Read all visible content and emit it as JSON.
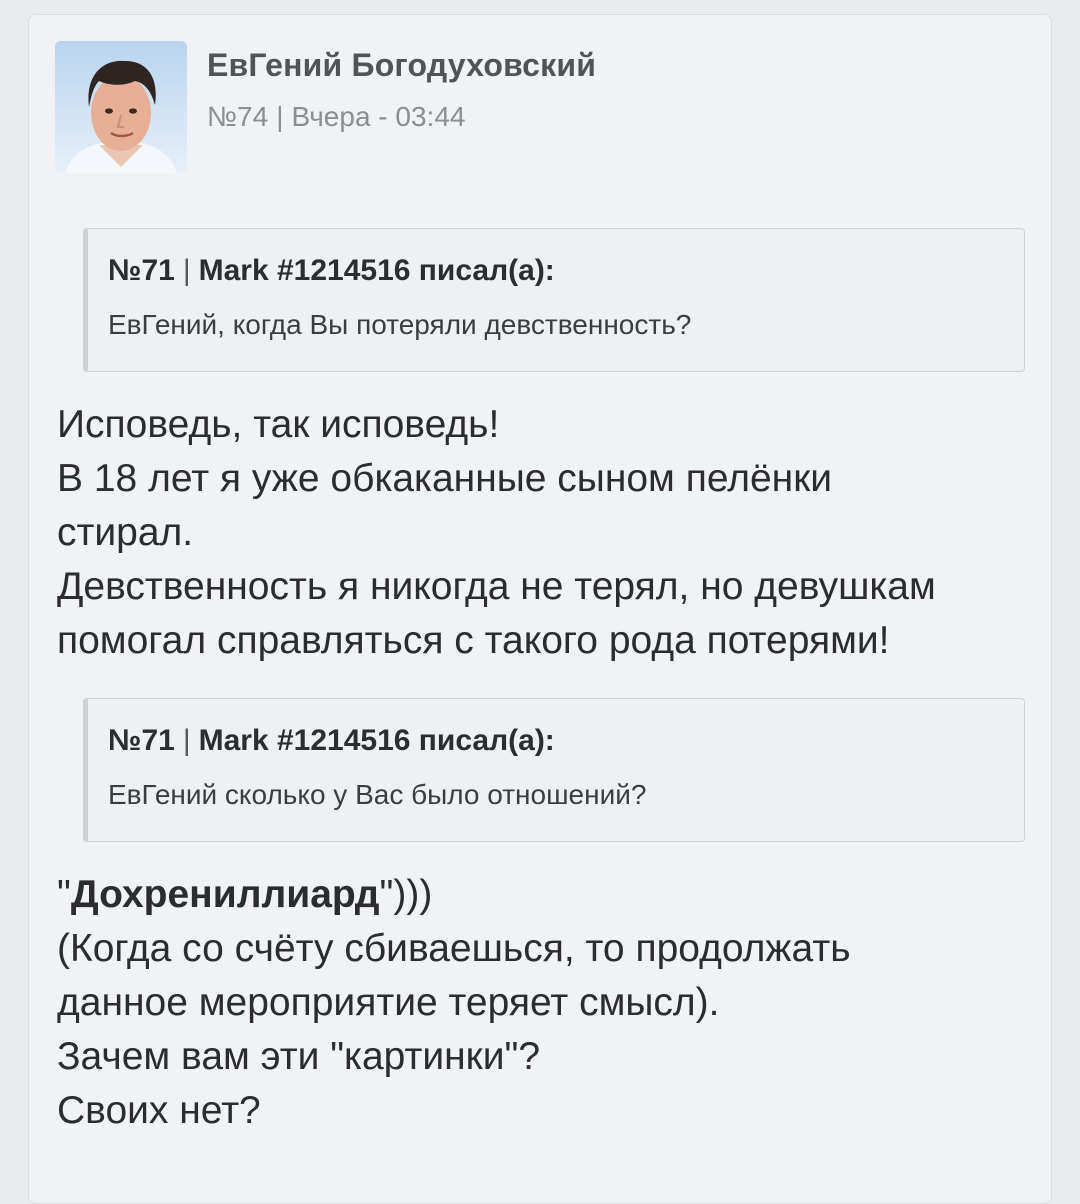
{
  "post": {
    "author": "ЕвГений Богодуховский",
    "number": "№74",
    "separator": "|",
    "time": "Вчера - 03:44",
    "avatar_icon": "user-photo-avatar"
  },
  "quotes": [
    {
      "number": "№71",
      "separator": "|",
      "author_label": "Mark #1214516 писал(а):",
      "text": "ЕвГений, когда Вы потеряли девственность?"
    },
    {
      "number": "№71",
      "separator": "|",
      "author_label": "Mark #1214516 писал(а):",
      "text": "ЕвГений сколько у Вас было отношений?"
    }
  ],
  "body1": {
    "lines": [
      "Исповедь, так исповедь!",
      "В 18 лет я уже обкаканные сыном пелёнки",
      "стирал.",
      "Девственность я никогда не терял, но девушкам",
      "помогал справляться с такого рода потерями!"
    ]
  },
  "body2": {
    "quote_open": "\"",
    "bold_word": "Дохрениллиард",
    "quote_close": "\")))",
    "lines": [
      "(Когда со счёту сбиваешься, то продолжать",
      "данное мероприятие теряет смысл).",
      "Зачем вам эти \"картинки\"?",
      "Своих нет?"
    ]
  },
  "colors": {
    "page_background": "#e9ebee",
    "card_background": "#f1f2f5",
    "quote_background": "#eef0f2",
    "author_text": "#515357",
    "meta_text": "#8a8d92",
    "body_text": "#2b2c2f"
  }
}
